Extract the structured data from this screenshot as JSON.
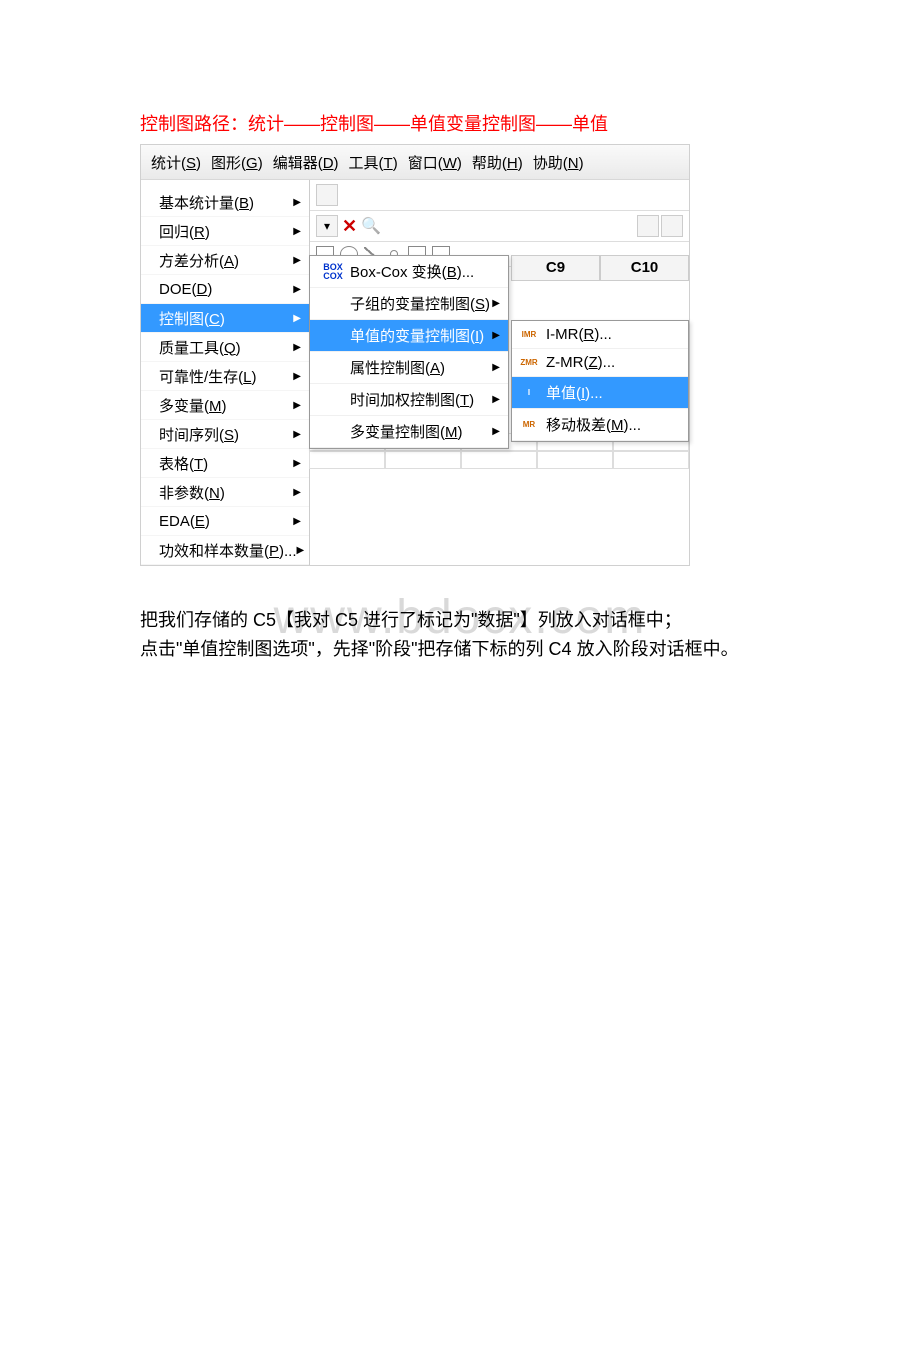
{
  "title_red": "控制图路径：统计——控制图——单值变量控制图——单值",
  "menubar": [
    {
      "label": "统计(",
      "accel": "S",
      "suffix": ")"
    },
    {
      "label": "图形(",
      "accel": "G",
      "suffix": ")"
    },
    {
      "label": "编辑器(",
      "accel": "D",
      "suffix": ")"
    },
    {
      "label": "工具(",
      "accel": "T",
      "suffix": ")"
    },
    {
      "label": "窗口(",
      "accel": "W",
      "suffix": ")"
    },
    {
      "label": "帮助(",
      "accel": "H",
      "suffix": ")"
    },
    {
      "label": "协助(",
      "accel": "N",
      "suffix": ")"
    }
  ],
  "left_menu": [
    {
      "label": "基本统计量(",
      "accel": "B",
      "suffix": ")",
      "arrow": true
    },
    {
      "label": "回归(",
      "accel": "R",
      "suffix": ")",
      "arrow": true
    },
    {
      "label": "方差分析(",
      "accel": "A",
      "suffix": ")",
      "arrow": true
    },
    {
      "label": "DOE(",
      "accel": "D",
      "suffix": ")",
      "arrow": true
    },
    {
      "label": "控制图(",
      "accel": "C",
      "suffix": ")",
      "arrow": true,
      "selected": true
    },
    {
      "label": "质量工具(",
      "accel": "Q",
      "suffix": ")",
      "arrow": true
    },
    {
      "label": "可靠性/生存(",
      "accel": "L",
      "suffix": ")",
      "arrow": true
    },
    {
      "label": "多变量(",
      "accel": "M",
      "suffix": ")",
      "arrow": true
    },
    {
      "label": "时间序列(",
      "accel": "S",
      "suffix": ")",
      "arrow": true
    },
    {
      "label": "表格(",
      "accel": "T",
      "suffix": ")",
      "arrow": true
    },
    {
      "label": "非参数(",
      "accel": "N",
      "suffix": ")",
      "arrow": true
    },
    {
      "label": "EDA(",
      "accel": "E",
      "suffix": ")",
      "arrow": true
    },
    {
      "label": "功效和样本数量(",
      "accel": "P",
      "suffix": ")...",
      "arrow": true
    }
  ],
  "columns": {
    "c9": "C9",
    "c10": "C10"
  },
  "submenu": [
    {
      "icon": "BOX\nCOX",
      "label": "Box-Cox 变换(",
      "accel": "B",
      "suffix": ")...",
      "arrow": false
    },
    {
      "icon": "",
      "label": "子组的变量控制图(",
      "accel": "S",
      "suffix": ")",
      "arrow": true
    },
    {
      "icon": "",
      "label": "单值的变量控制图(",
      "accel": "I",
      "suffix": ")",
      "arrow": true,
      "selected": true
    },
    {
      "icon": "",
      "label": "属性控制图(",
      "accel": "A",
      "suffix": ")",
      "arrow": true
    },
    {
      "icon": "",
      "label": "时间加权控制图(",
      "accel": "T",
      "suffix": ")",
      "arrow": true
    },
    {
      "icon": "",
      "label": "多变量控制图(",
      "accel": "M",
      "suffix": ")",
      "arrow": true
    }
  ],
  "submenu2": [
    {
      "icon": "IMR",
      "label": "I-MR(",
      "accel": "R",
      "suffix": ")..."
    },
    {
      "icon": "ZMR",
      "label": "Z-MR(",
      "accel": "Z",
      "suffix": ")..."
    },
    {
      "icon": "I",
      "label": "单值(",
      "accel": "I",
      "suffix": ")...",
      "selected": true
    },
    {
      "icon": "MR",
      "label": "移动极差(",
      "accel": "M",
      "suffix": ")..."
    }
  ],
  "body": {
    "line1": "把我们存储的 C5【我对 C5 进行了标记为\"数据\"】列放入对话框中；",
    "line2": "点击\"单值控制图选项\"，先择\"阶段\"把存储下标的列 C4 放入阶段对话框中。"
  },
  "watermark": "www.bdocx.com",
  "glyphs": {
    "arrow": "▶",
    "x": "✕",
    "search": "🔍",
    "dropdown": "▾"
  }
}
